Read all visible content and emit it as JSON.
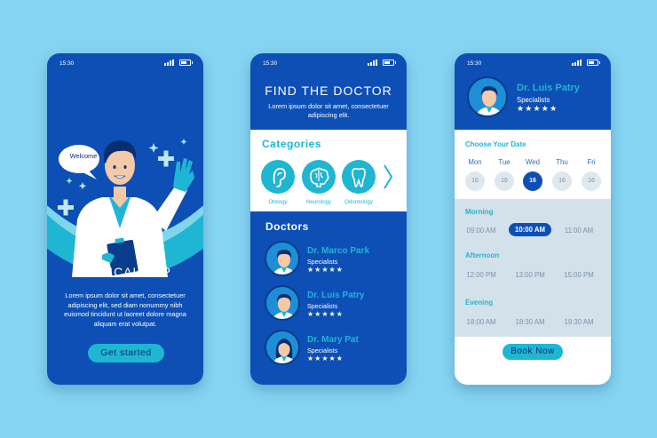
{
  "colors": {
    "background": "#85d4f2",
    "primary": "#0d4fb5",
    "accent": "#1fb6d4",
    "light": "#d3e1ea"
  },
  "status": {
    "time": "15:30"
  },
  "screen1": {
    "bubble": "Welcome",
    "title": "MEDICAL APP",
    "text": "Lorem ipsum dolor sit amet, consectetuer adipiscing elit, sed diam nonummy nibh euismod tincidunt ut laoreet dolore magna aliquam erat volutpat.",
    "button": "Get started"
  },
  "screen2": {
    "title": "FIND THE DOCTOR",
    "subtitle": "Lorem ipsum dolor sit amet, consectetuer adipiscing elit.",
    "categories_title": "Categories",
    "categories": [
      {
        "label": "Otology",
        "icon": "ear-icon"
      },
      {
        "label": "Neurology",
        "icon": "brain-icon"
      },
      {
        "label": "Odontology",
        "icon": "tooth-icon"
      }
    ],
    "doctors_title": "Doctors",
    "doctors": [
      {
        "name": "Dr. Marco Park",
        "specialty": "Specialists",
        "stars": "★★★★★"
      },
      {
        "name": "Dr. Luis Patry",
        "specialty": "Specialists",
        "stars": "★★★★★"
      },
      {
        "name": "Dr. Mary Pat",
        "specialty": "Specialists",
        "stars": "★★★★★"
      }
    ]
  },
  "screen3": {
    "doctor_name": "Dr. Luis Patry",
    "specialty": "Specialists",
    "stars": "★★★★★",
    "choose_date": "Choose Your Date",
    "days": [
      {
        "name": "Mon",
        "date": "16"
      },
      {
        "name": "Tue",
        "date": "16"
      },
      {
        "name": "Wed",
        "date": "16"
      },
      {
        "name": "Thu",
        "date": "16"
      },
      {
        "name": "Fri",
        "date": "16"
      }
    ],
    "selected_day": "Wed",
    "sections": [
      {
        "label": "Morning",
        "times": [
          "09:00 AM",
          "10:00 AM",
          "11:00 AM"
        ]
      },
      {
        "label": "Afternoon",
        "times": [
          "12:00 PM",
          "13:00 PM",
          "15:00 PM"
        ]
      },
      {
        "label": "Evening",
        "times": [
          "18:00 AM",
          "18:30 AM",
          "19:30 AM"
        ]
      }
    ],
    "selected_time": "10:00 AM",
    "button": "Book Now"
  }
}
